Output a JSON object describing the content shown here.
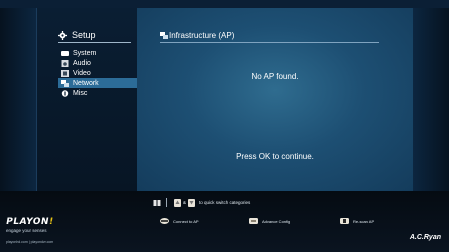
{
  "sidebar": {
    "header": "Setup",
    "items": [
      {
        "label": "System",
        "icon": "system-icon",
        "selected": false
      },
      {
        "label": "Audio",
        "icon": "audio-icon",
        "selected": false
      },
      {
        "label": "Video",
        "icon": "video-icon",
        "selected": false
      },
      {
        "label": "Network",
        "icon": "network-icon",
        "selected": true
      },
      {
        "label": "Misc",
        "icon": "misc-icon",
        "selected": false
      }
    ]
  },
  "main": {
    "title": "Infrastructure (AP)",
    "message": "No AP found.",
    "prompt": "Press OK to continue."
  },
  "footer": {
    "hint_amp": "&",
    "hint_text": "to quick switch categories",
    "buttons": [
      {
        "label": "Connect to AP",
        "icon": "ok-button-icon"
      },
      {
        "label": "Advance Config",
        "icon": "menu-button-icon"
      },
      {
        "label": "Re-scan AP",
        "icon": "rescan-button-icon"
      }
    ]
  },
  "branding": {
    "logo_a": "PLAYON",
    "logo_b": "!",
    "tagline": "engage your senses",
    "urls": "playonhd.com | playondvr.com",
    "maker": "A.C.Ryan"
  },
  "colors": {
    "selected_bg": "#2c6c98",
    "accent_yellow": "#e7c215",
    "main_bg": "#1d4f73"
  }
}
